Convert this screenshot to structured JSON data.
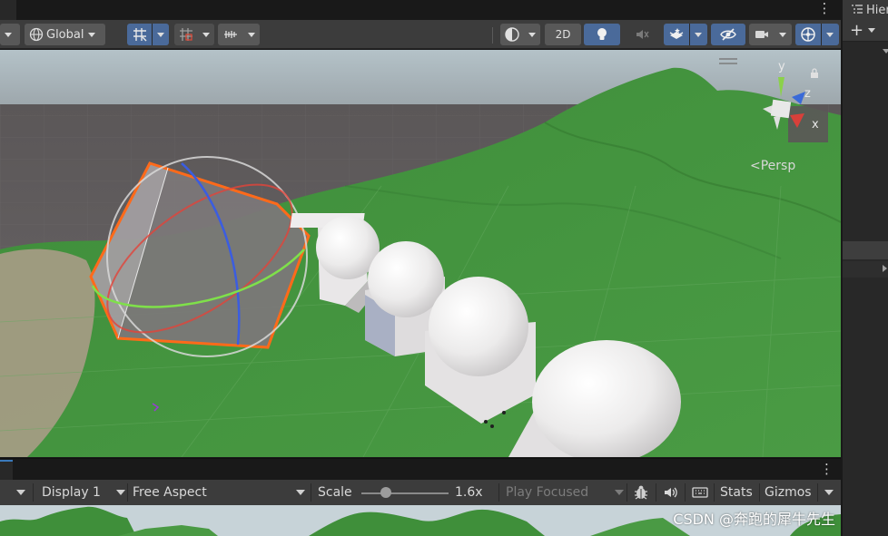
{
  "scene_toolbar": {
    "pivot_rotation_label": "Global",
    "mode_2d_label": "2D"
  },
  "scene_view": {
    "projection_label": "Persp",
    "gizmo_axes": {
      "y": "y",
      "z": "z",
      "x": "x"
    }
  },
  "hierarchy": {
    "tab_label": "Hierarchy"
  },
  "game_toolbar": {
    "display_label": "Display 1",
    "aspect_label": "Free Aspect",
    "scale_label": "Scale",
    "scale_value": "1.6x",
    "scale_fraction": 0.28,
    "play_mode_label": "Play Focused",
    "stats_label": "Stats",
    "gizmos_label": "Gizmos"
  },
  "watermark": {
    "text": "CSDN @奔跑的犀牛先生"
  },
  "colors": {
    "toolbar_bg": "#3c3c3c",
    "active_button": "#4a6a9a",
    "terrain_green": "#3f8f3a",
    "sky_top": "#b4c2c8",
    "selection_outline": "#ff6a1a"
  }
}
